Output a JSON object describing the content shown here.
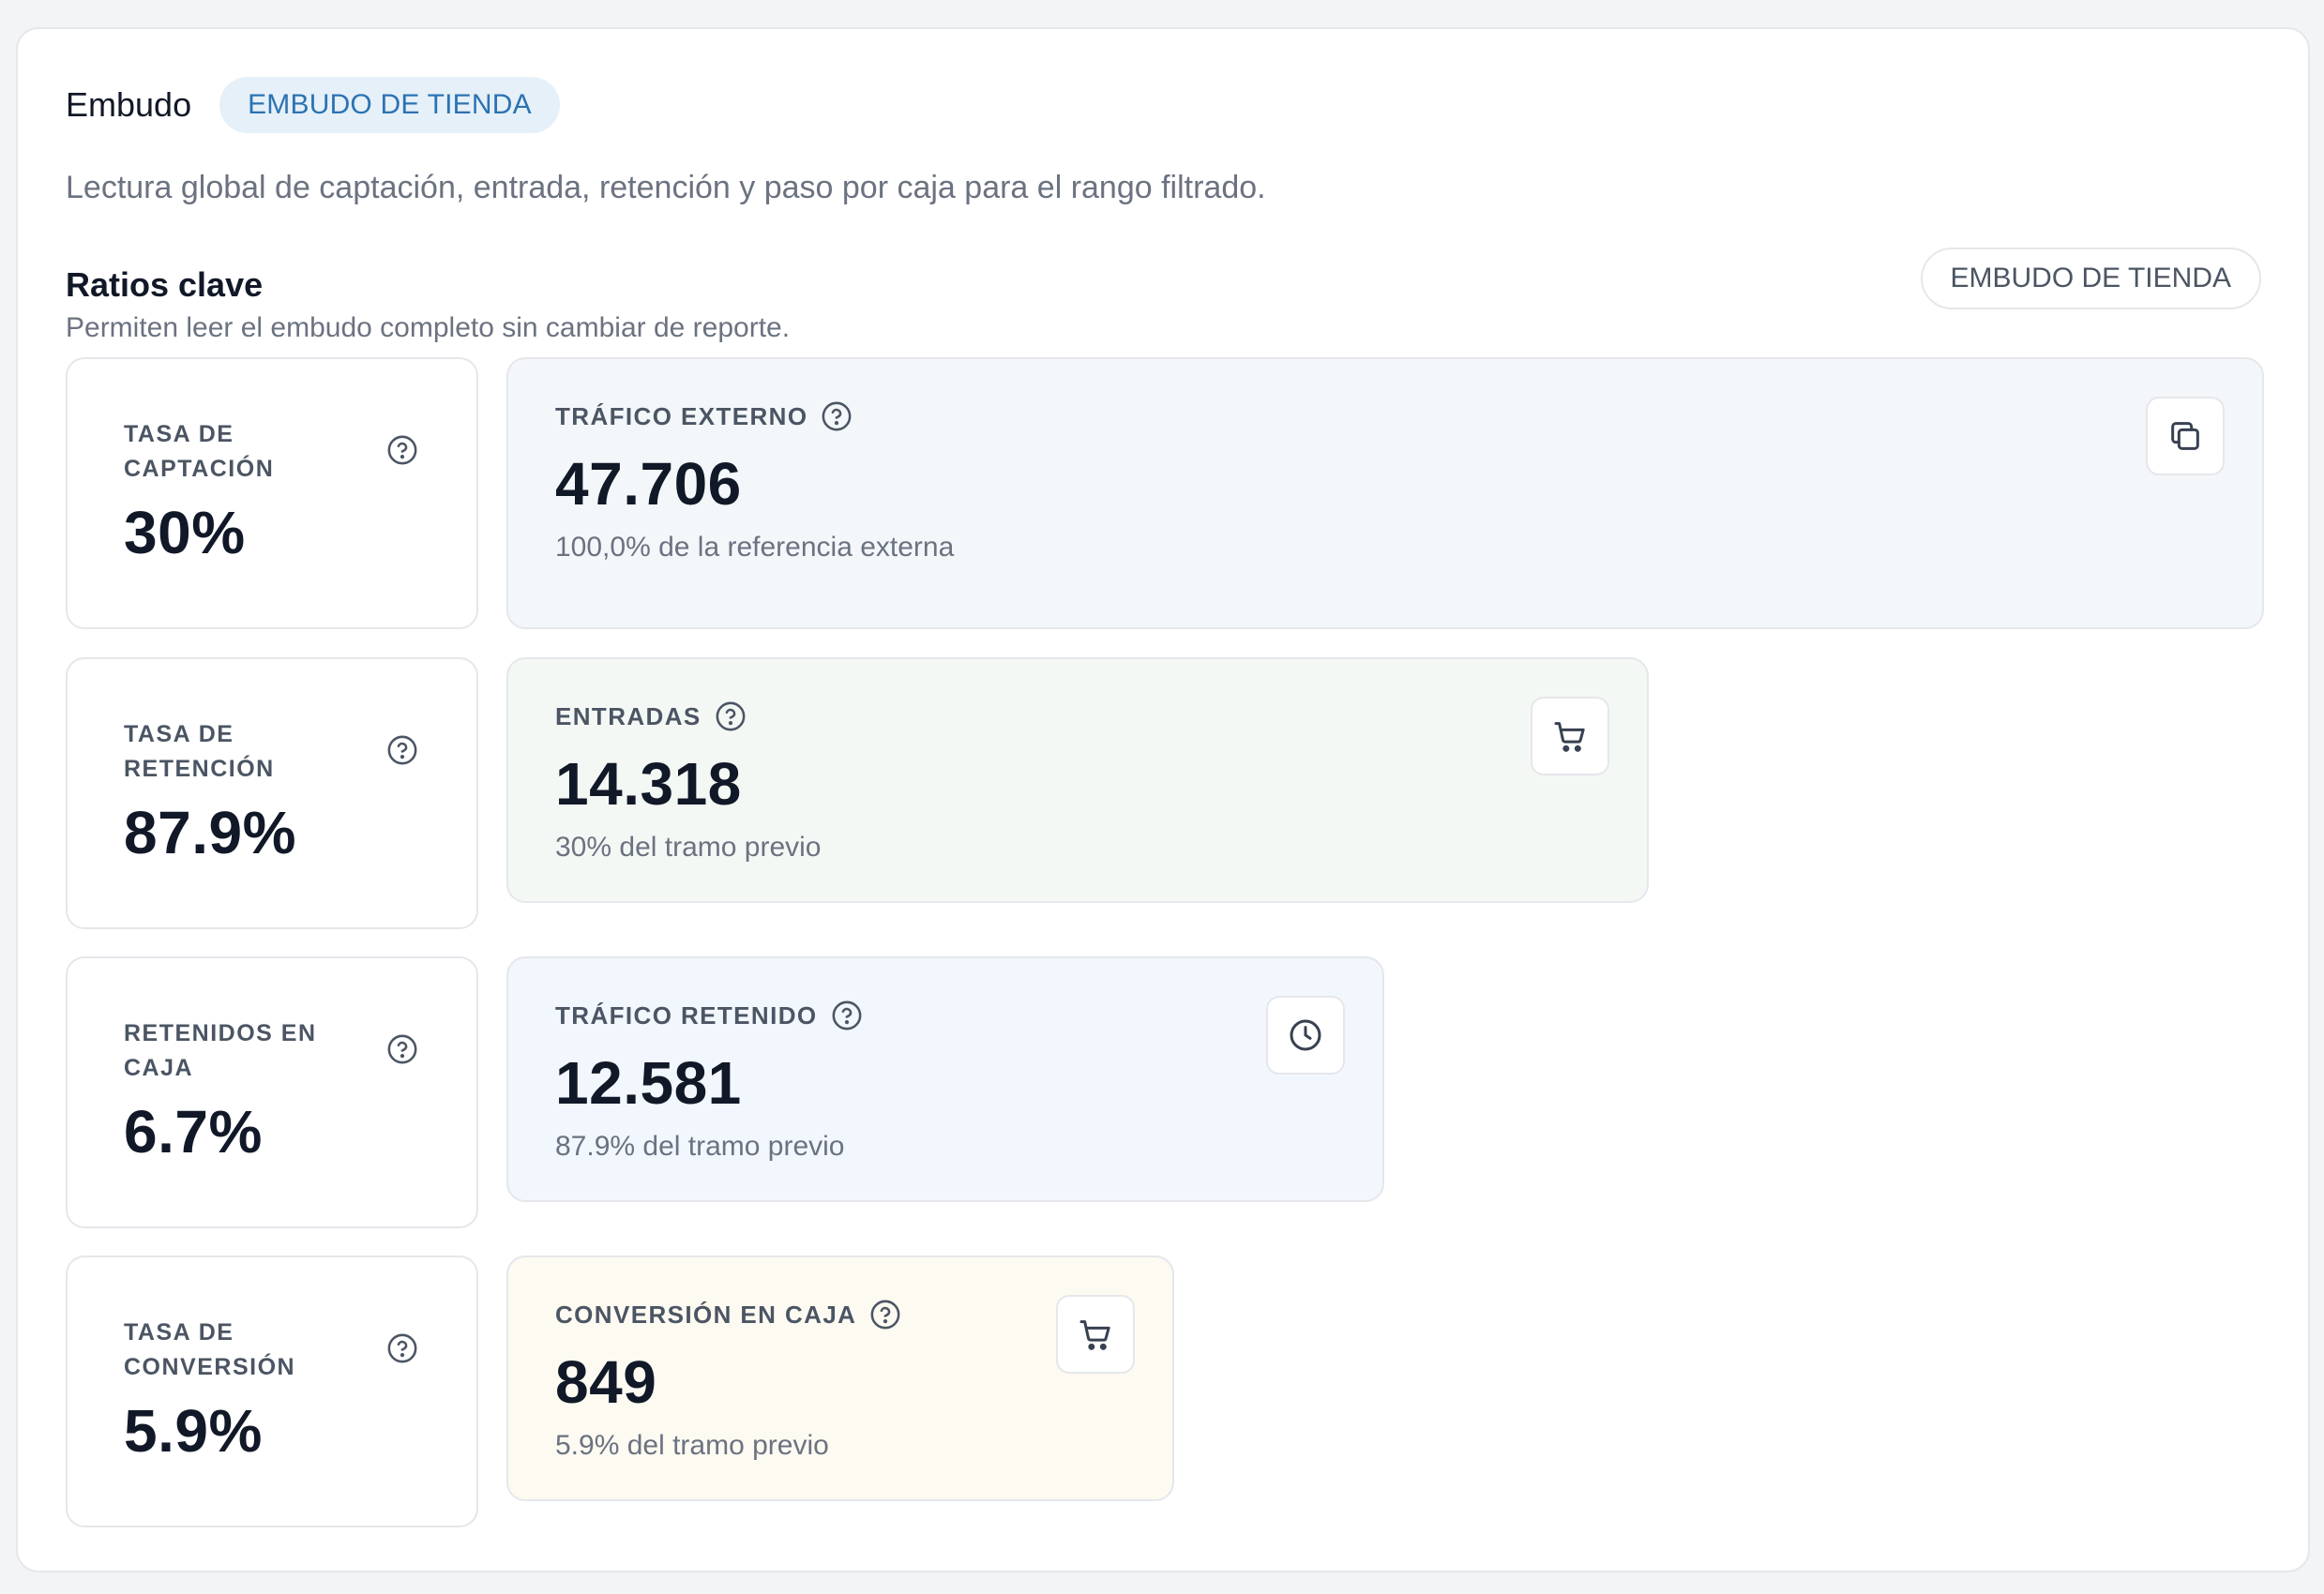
{
  "header": {
    "title": "Embudo",
    "badge": "EMBUDO DE TIENDA",
    "description": "Lectura global de captación, entrada, retención y paso por caja para el rango filtrado."
  },
  "section": {
    "title": "Ratios clave",
    "subtitle": "Permiten leer el embudo completo sin cambiar de reporte.",
    "tag": "EMBUDO DE TIENDA"
  },
  "ratios": [
    {
      "label": "TASA DE CAPTACIÓN",
      "value": "30%"
    },
    {
      "label": "TASA DE RETENCIÓN",
      "value": "87.9%"
    },
    {
      "label": "RETENIDOS EN CAJA",
      "value": "6.7%"
    },
    {
      "label": "TASA DE CONVERSIÓN",
      "value": "5.9%"
    }
  ],
  "stages": [
    {
      "label": "TRÁFICO EXTERNO",
      "value": "47.706",
      "sub": "100,0% de la referencia externa",
      "icon": "copy-icon",
      "bg": "#f4f7fa",
      "share": 1.0
    },
    {
      "label": "ENTRADAS",
      "value": "14.318",
      "sub": "30% del tramo previo",
      "icon": "cart-icon",
      "bg": "#f4f8f5",
      "share": 0.3
    },
    {
      "label": "TRÁFICO RETENIDO",
      "value": "12.581",
      "sub": "87.9% del tramo previo",
      "icon": "clock-icon",
      "bg": "#f2f6fd",
      "share": 0.264
    },
    {
      "label": "CONVERSIÓN EN CAJA",
      "value": "849",
      "sub": "5.9% del tramo previo",
      "icon": "cart-icon",
      "bg": "#fdfaf2",
      "share": 0.018
    }
  ]
}
